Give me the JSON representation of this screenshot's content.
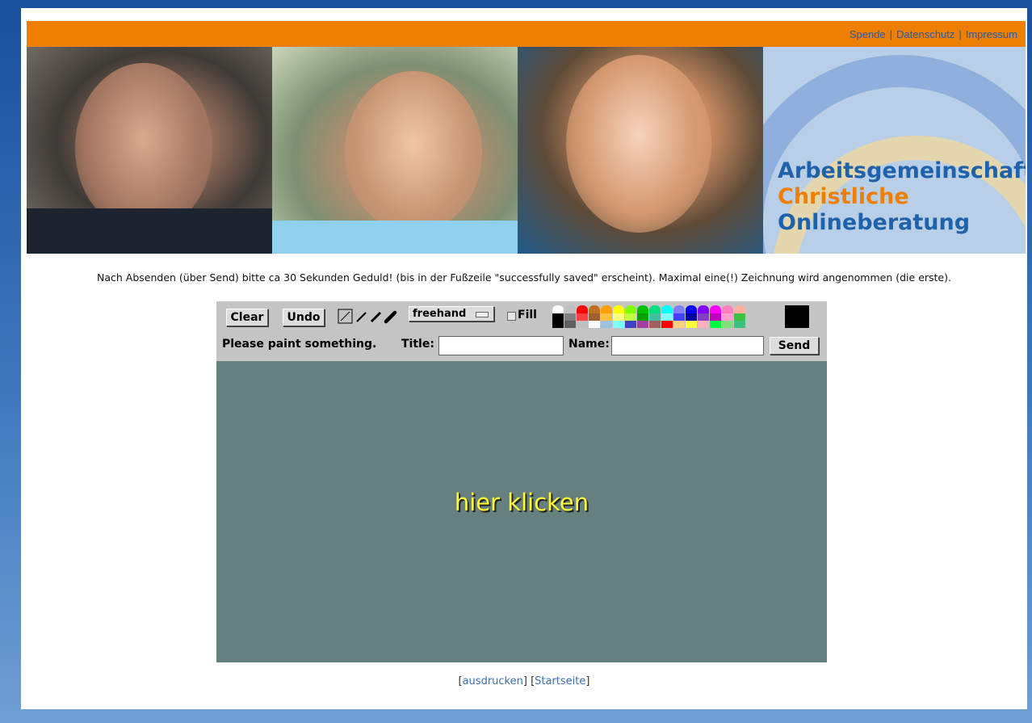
{
  "topnav": {
    "items": [
      "Spende",
      "Datenschutz",
      "Impressum"
    ],
    "separator": "|"
  },
  "logo": {
    "line1": "Arbeitsgemeinschaft",
    "line2": "Christliche",
    "line3": "Onlineberatung"
  },
  "notice": "Nach Absenden (über Send) bitte ca 30 Sekunden Geduld! (bis in der Fußzeile \"successfully saved\" erscheint). Maximal eine(!) Zeichnung wird angenommen (die erste).",
  "toolbar": {
    "clear_label": "Clear",
    "undo_label": "Undo",
    "mode_label": "freehand",
    "fill_label": "Fill",
    "status": "Please paint something.",
    "title_label": "Title:",
    "title_value": "",
    "name_label": "Name:",
    "name_value": "",
    "send_label": "Send",
    "current_color": "#000000"
  },
  "canvas": {
    "hint": "hier klicken",
    "background": "#668080"
  },
  "footer": {
    "print_label": "ausdrucken",
    "home_label": "Startseite"
  },
  "colors": {
    "orange_bar": "#ee7f00",
    "link_blue": "#2a5aa0"
  }
}
